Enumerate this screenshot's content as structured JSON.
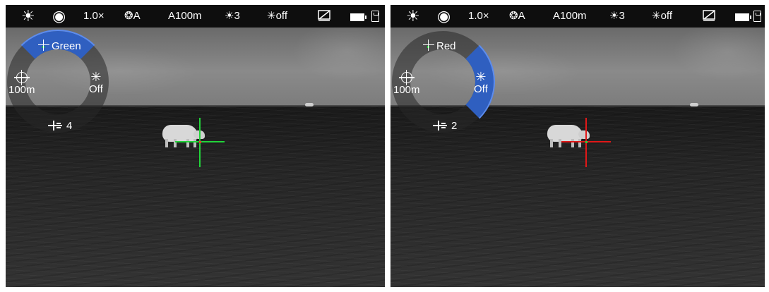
{
  "screens": [
    {
      "id": "left",
      "status": {
        "zoom": "1.0×",
        "calibration": "A",
        "profile": "A100m",
        "brightness": "3",
        "illuminator": "off"
      },
      "menu": {
        "reticle_color": "Green",
        "distance": "100m",
        "illuminator": "Off",
        "reticle_brightness": "4",
        "selected": "reticle_color"
      },
      "reticle": {
        "color": "#22d43a",
        "dot_color": "#ff3030"
      }
    },
    {
      "id": "right",
      "status": {
        "zoom": "1.0×",
        "calibration": "A",
        "profile": "A100m",
        "brightness": "3",
        "illuminator": "off"
      },
      "menu": {
        "reticle_color": "Red",
        "distance": "100m",
        "illuminator": "Off",
        "reticle_brightness": "2",
        "selected": "illuminator"
      },
      "reticle": {
        "color": "#e01818",
        "dot_color": "#22d43a"
      }
    }
  ],
  "icons": {
    "brightness_mode": "sun-icon",
    "observation_mode": "eye-icon",
    "calibration": "aperture-icon",
    "brightness": "sun-small-icon",
    "illuminator": "snowflake-icon",
    "display_off": "display-off-icon",
    "battery": "battery-icon",
    "storage": "sd-card-icon"
  },
  "colors": {
    "highlight": "#2f5fc0",
    "statusbar": "#0e0e0e"
  }
}
